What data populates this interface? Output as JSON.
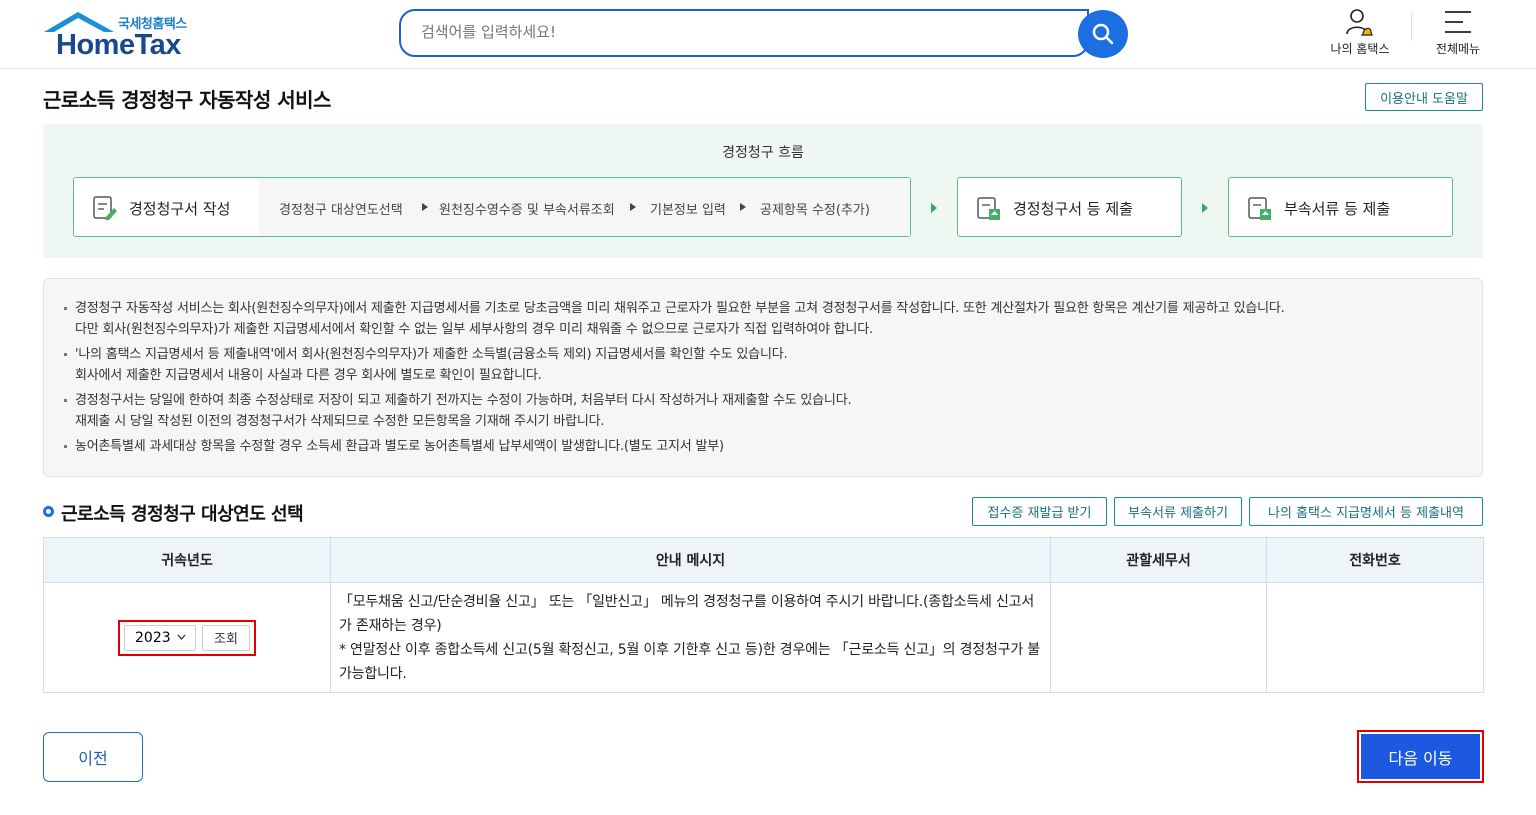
{
  "header": {
    "logo_sub": "국세청홈택스",
    "logo_main": "HomeTax",
    "search_placeholder": "검색어를 입력하세요!",
    "my_hometax": "나의 홈택스",
    "full_menu": "전체메뉴"
  },
  "page": {
    "title": "근로소득 경정청구 자동작성 서비스",
    "help_button": "이용안내 도움말"
  },
  "flow": {
    "title": "경정청구 흐름",
    "step1_label": "경정청구서 작성",
    "substeps": [
      "경정청구 대상연도선택",
      "원천징수영수증 및 부속서류조회",
      "기본정보 입력",
      "공제항목 수정(추가)"
    ],
    "step2_label": "경정청구서 등 제출",
    "step3_label": "부속서류 등 제출"
  },
  "notice": [
    [
      "경정청구 자동작성 서비스는 회사(원천징수의무자)에서 제출한 지급명세서를 기초로 당초금액을 미리 채워주고 근로자가 필요한 부분을 고쳐 경정청구서를 작성합니다. 또한 계산절차가 필요한 항목은 계산기를 제공하고 있습니다.",
      "다만 회사(원천징수의무자)가 제출한 지급명세서에서 확인할 수 없는 일부 세부사항의 경우 미리 채워줄 수 없으므로 근로자가 직접 입력하여야 합니다."
    ],
    [
      "'나의 홈택스 지급명세서 등 제출내역'에서 회사(원천징수의무자)가 제출한 소득별(금융소득 제외) 지급명세서를 확인할 수도 있습니다.",
      "회사에서 제출한 지급명세서 내용이 사실과 다른 경우 회사에 별도로 확인이 필요합니다."
    ],
    [
      "경정청구서는 당일에 한하여 최종 수정상태로 저장이 되고 제출하기 전까지는 수정이 가능하며, 처음부터 다시 작성하거나 재제출할 수도 있습니다.",
      "재제출 시 당일 작성된 이전의 경정청구서가 삭제되므로 수정한 모든항목을 기재해 주시기 바랍니다."
    ],
    [
      "농어촌특별세 과세대상 항목을 수정할 경우 소득세 환급과 별도로 농어촌특별세 납부세액이 발생합니다.(별도 고지서 발부)",
      ""
    ]
  ],
  "section": {
    "title": "근로소득 경정청구 대상연도 선택",
    "btn_reissue": "접수증 재발급 받기",
    "btn_attach": "부속서류 제출하기",
    "btn_statement": "나의 홈택스 지급명세서 등 제출내역"
  },
  "table": {
    "headers": [
      "귀속년도",
      "안내 메시지",
      "관할세무서",
      "전화번호"
    ],
    "year_value": "2023",
    "query_button": "조회",
    "message_line1": "「모두채움 신고/단순경비율 신고」 또는 「일반신고」 메뉴의 경정청구를 이용하여 주시기 바랍니다.(종합소득세 신고서가 존재하는 경우)",
    "message_line2": "* 연말정산 이후 종합소득세 신고(5월 확정신고, 5월 이후 기한후 신고 등)한 경우에는 「근로소득 신고」의 경정청구가 불가능합니다.",
    "tax_office": "",
    "phone": ""
  },
  "footer": {
    "prev_button": "이전",
    "next_button": "다음 이동"
  },
  "colors": {
    "primary_blue": "#1c58e0",
    "teal_border": "#1f8a8f",
    "flow_bg": "#eef7f2",
    "highlight_red": "#e00000"
  }
}
